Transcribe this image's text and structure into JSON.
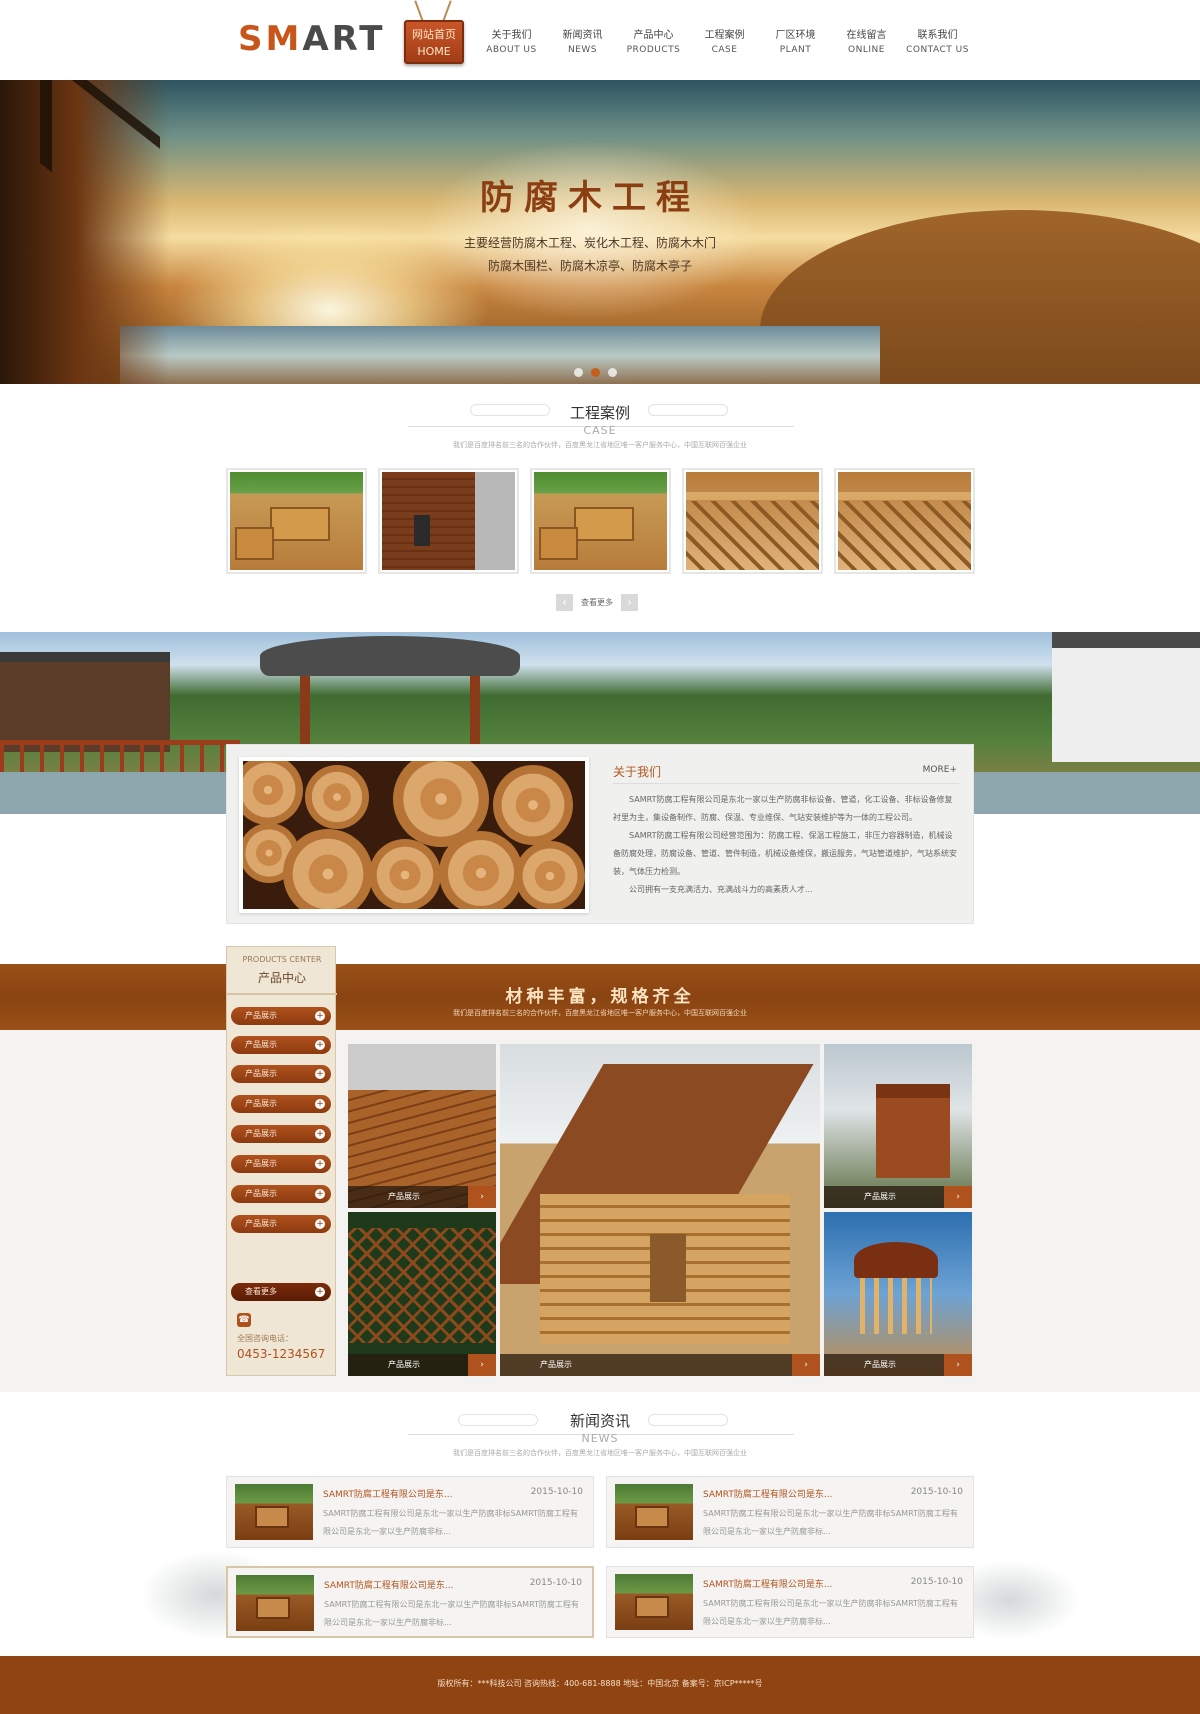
{
  "header": {
    "logo_part1": "SM",
    "logo_part2": "ART",
    "home": {
      "cn": "网站首页",
      "en": "HOME"
    },
    "nav": [
      {
        "cn": "关于我们",
        "en": "ABOUT US"
      },
      {
        "cn": "新闻资讯",
        "en": "NEWS"
      },
      {
        "cn": "产品中心",
        "en": "PRODUCTS"
      },
      {
        "cn": "工程案例",
        "en": "CASE"
      },
      {
        "cn": "厂区环境",
        "en": "PLANT"
      },
      {
        "cn": "在线留言",
        "en": "ONLINE"
      },
      {
        "cn": "联系我们",
        "en": "CONTACT US"
      }
    ]
  },
  "banner": {
    "title": "防腐木工程",
    "subtitle_line1": "主要经营防腐木工程、炭化木工程、防腐木木门",
    "subtitle_line2": "防腐木围栏、防腐木凉亭、防腐木亭子",
    "slide_count": 3,
    "active_slide": 2
  },
  "case_section": {
    "title_cn": "工程案例",
    "title_en": "CASE",
    "desc": "我们是百度排名前三名的合作伙伴，百度黑龙江省地区唯一客户服务中心，中国互联网百强企业",
    "more_label": "查看更多",
    "prev_icon": "‹",
    "next_icon": "›"
  },
  "about": {
    "title": "关于我们",
    "more": "MORE+",
    "para1": "SAMRT防腐工程有限公司是东北一家以生产防腐非标设备、管道，化工设备、非标设备修复衬里为主，集设备制作、防腐、保温、专业维保、气站安装维护等为一体的工程公司。",
    "para2": "SAMRT防腐工程有限公司经营范围为：防腐工程、保温工程施工，非压力容器制造，机械设备防腐处理，防腐设备、管道、管件制造，机械设备维保，搬运服务，气站管道维护，气站系统安装，气体压力检测。",
    "para3": "公司拥有一支充满活力、充满战斗力的高素质人才..."
  },
  "products": {
    "band_title": "材种丰富，规格齐全",
    "band_desc": "我们是百度排名前三名的合作伙伴，百度黑龙江省地区唯一客户服务中心，中国互联网百强企业",
    "side_en": "PRODUCTS CENTER",
    "side_cn": "产品中心",
    "categories": [
      "产品展示",
      "产品展示",
      "产品展示",
      "产品展示",
      "产品展示",
      "产品展示",
      "产品展示",
      "产品展示"
    ],
    "more_label": "查看更多",
    "phone_label": "全国咨询电话：",
    "phone": "0453-1234567",
    "caption": "产品展示",
    "go_icon": "›",
    "plus_icon": "+"
  },
  "news_section": {
    "title_cn": "新闻资讯",
    "title_en": "NEWS",
    "desc": "我们是百度排名前三名的合作伙伴，百度黑龙江省地区唯一客户服务中心，中国互联网百强企业",
    "items": [
      {
        "title": "SAMRT防腐工程有限公司是东...",
        "date": "2015-10-10",
        "summary": "SAMRT防腐工程有限公司是东北一家以生产防腐非标SAMRT防腐工程有限公司是东北一家以生产防腐非标..."
      },
      {
        "title": "SAMRT防腐工程有限公司是东...",
        "date": "2015-10-10",
        "summary": "SAMRT防腐工程有限公司是东北一家以生产防腐非标SAMRT防腐工程有限公司是东北一家以生产防腐非标..."
      },
      {
        "title": "SAMRT防腐工程有限公司是东...",
        "date": "2015-10-10",
        "summary": "SAMRT防腐工程有限公司是东北一家以生产防腐非标SAMRT防腐工程有限公司是东北一家以生产防腐非标..."
      },
      {
        "title": "SAMRT防腐工程有限公司是东...",
        "date": "2015-10-10",
        "summary": "SAMRT防腐工程有限公司是东北一家以生产防腐非标SAMRT防腐工程有限公司是东北一家以生产防腐非标..."
      }
    ]
  },
  "footer": {
    "text": "版权所有：***科技公司   咨询热线：400-681-8888   地址：中国北京   备案号：京ICP*****号"
  },
  "colors": {
    "brand": "#b0521d",
    "band": "#8f4412"
  }
}
